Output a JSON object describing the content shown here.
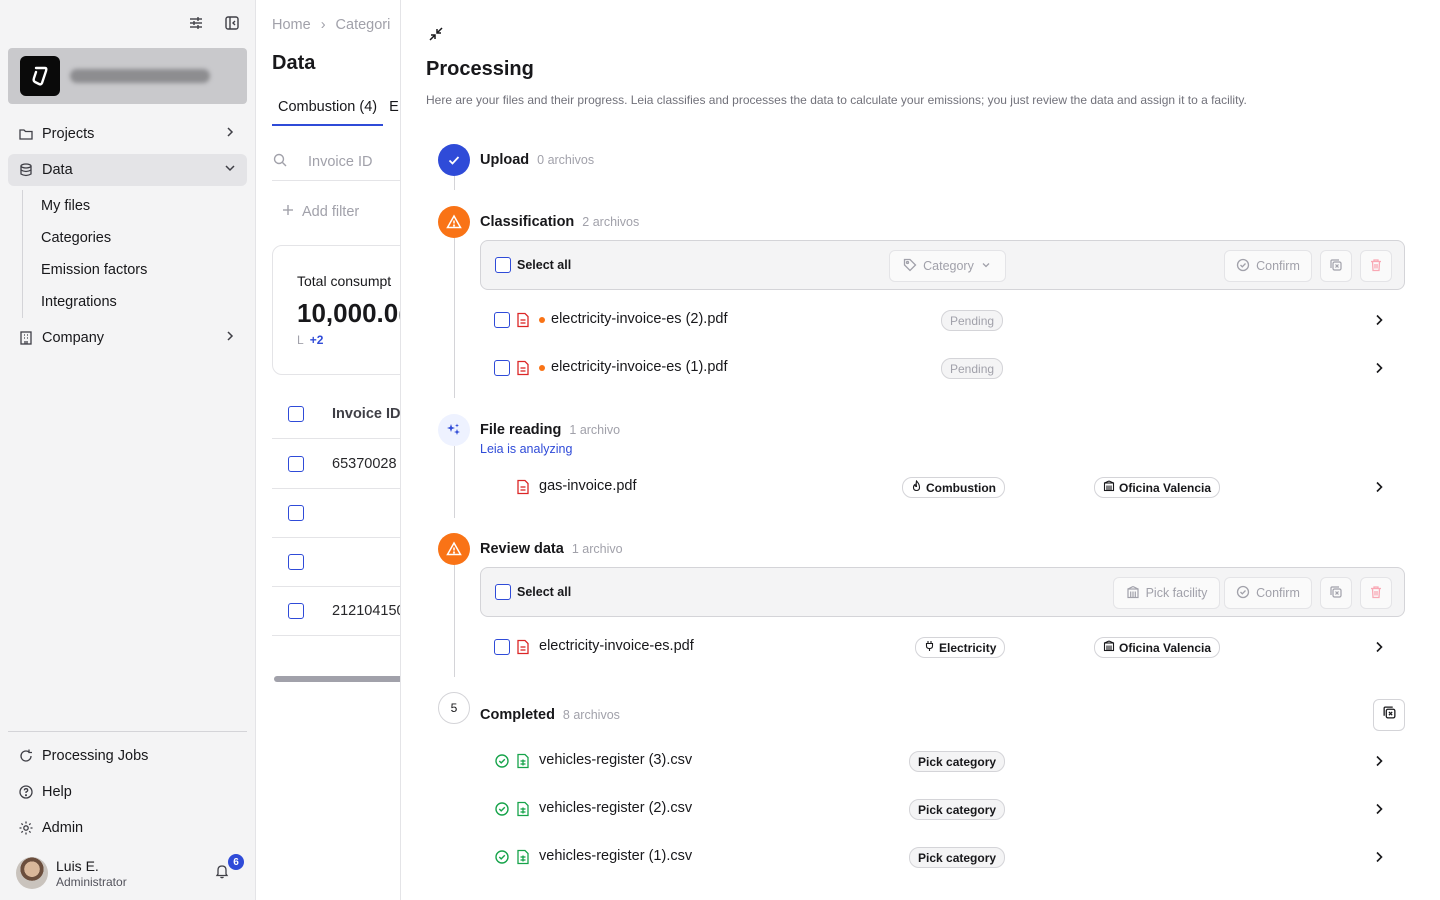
{
  "sidebar": {
    "nav": [
      {
        "label": "Projects"
      },
      {
        "label": "Data"
      },
      {
        "label": "Company"
      }
    ],
    "data_sub": [
      "My files",
      "Categories",
      "Emission factors",
      "Integrations"
    ],
    "bottom": [
      {
        "label": "Processing Jobs"
      },
      {
        "label": "Help"
      },
      {
        "label": "Admin"
      }
    ],
    "user": {
      "name": "Luis E.",
      "role": "Administrator",
      "notifications": "6"
    }
  },
  "background": {
    "breadcrumb": [
      "Home",
      "Categori"
    ],
    "title": "Data",
    "tab_active": "Combustion (4)",
    "tab_next": "E",
    "search_placeholder": "Invoice ID",
    "add_filter": "Add filter",
    "card": {
      "label": "Total consumpt",
      "value": "10,000.0(",
      "unit": "L",
      "more": "+2"
    },
    "table_header": "Invoice ID",
    "rows": [
      "65370028",
      "",
      "",
      "212104150"
    ]
  },
  "panel": {
    "title": "Processing",
    "subtitle": "Here are your files and their progress. Leia classifies and processes the data to calculate your emissions; you just review the data and assign it to a facility.",
    "steps": {
      "upload": {
        "title": "Upload",
        "count": "0 archivos"
      },
      "classification": {
        "title": "Classification",
        "count": "2 archivos",
        "toolbar": {
          "select_all": "Select all",
          "category": "Category",
          "confirm": "Confirm"
        },
        "files": [
          {
            "name": "electricity-invoice-es (2).pdf",
            "status": "Pending"
          },
          {
            "name": "electricity-invoice-es (1).pdf",
            "status": "Pending"
          }
        ]
      },
      "reading": {
        "title": "File reading",
        "count": "1 archivo",
        "note": "Leia is analyzing",
        "files": [
          {
            "name": "gas-invoice.pdf",
            "category": "Combustion",
            "facility": "Oficina Valencia"
          }
        ]
      },
      "review": {
        "title": "Review data",
        "count": "1 archivo",
        "toolbar": {
          "select_all": "Select all",
          "pick_facility": "Pick facility",
          "confirm": "Confirm"
        },
        "files": [
          {
            "name": "electricity-invoice-es.pdf",
            "category": "Electricity",
            "facility": "Oficina Valencia"
          }
        ]
      },
      "completed": {
        "number": "5",
        "title": "Completed",
        "count": "8 archivos",
        "files": [
          {
            "name": "vehicles-register (3).csv",
            "action": "Pick category"
          },
          {
            "name": "vehicles-register (2).csv",
            "action": "Pick category"
          },
          {
            "name": "vehicles-register (1).csv",
            "action": "Pick category"
          }
        ]
      }
    }
  },
  "colors": {
    "accent": "#2f4bd8",
    "warning": "#f97316",
    "success": "#16a34a",
    "danger": "#dc2626"
  }
}
